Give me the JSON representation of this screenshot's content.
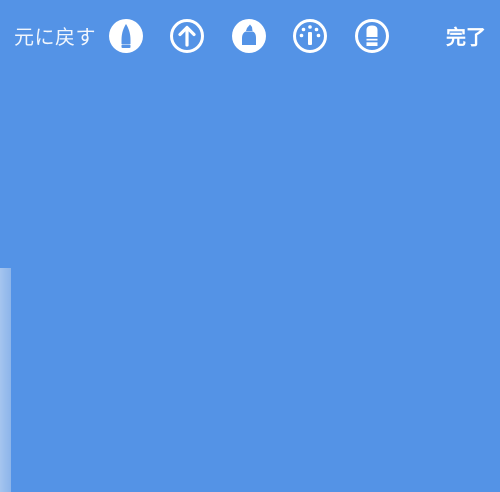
{
  "toolbar": {
    "undo_label": "元に戻す",
    "done_label": "完了",
    "tools": [
      {
        "icon": "marker-pen-icon"
      },
      {
        "icon": "arrow-up-icon"
      },
      {
        "icon": "highlighter-icon"
      },
      {
        "icon": "color-palette-icon"
      },
      {
        "icon": "eraser-icon"
      }
    ]
  },
  "colors": {
    "background": "#5493e6",
    "icon": "#ffffff"
  }
}
